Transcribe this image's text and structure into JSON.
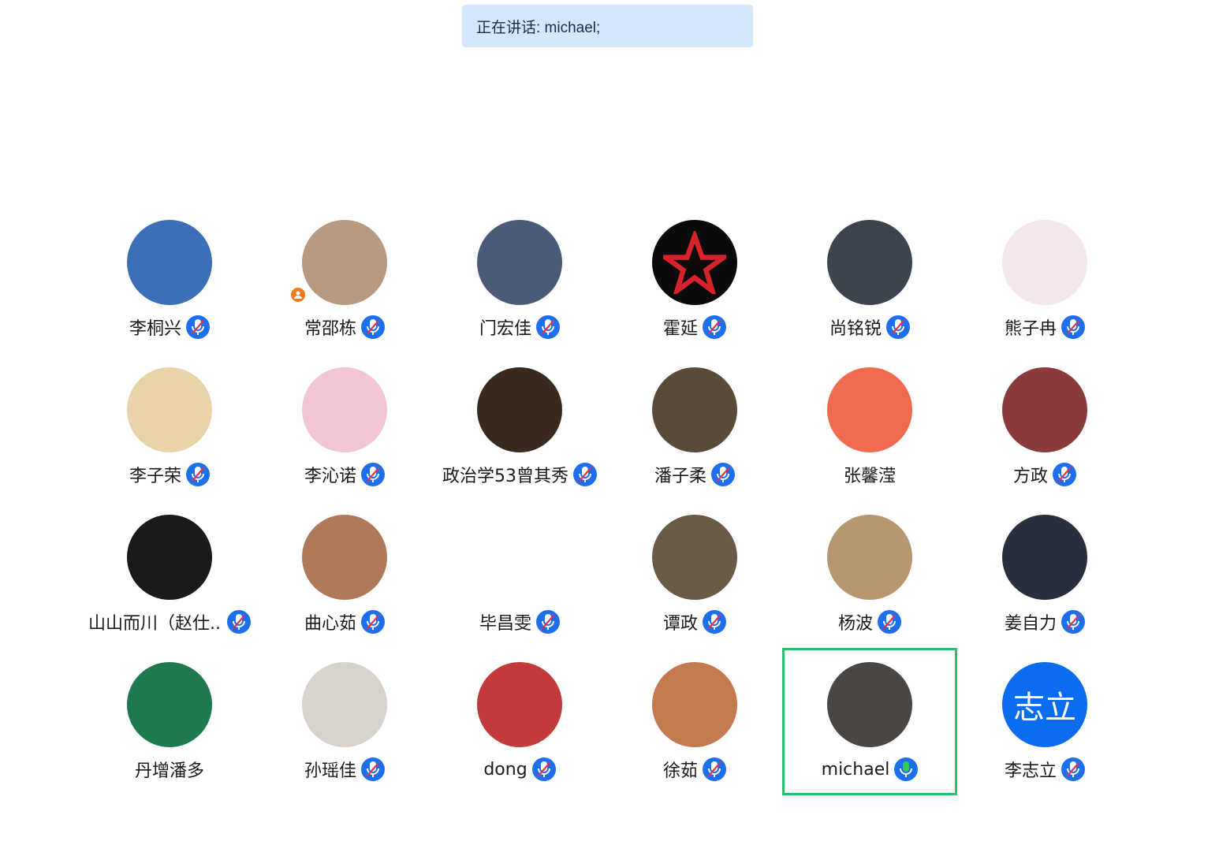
{
  "banner": {
    "text": "正在讲话: michael;"
  },
  "participants": [
    {
      "name": "李桐兴",
      "mic": "muted",
      "avatar_color": "#3b6fb6"
    },
    {
      "name": "常邵栋",
      "mic": "muted",
      "avatar_color": "#b89a82",
      "host": true
    },
    {
      "name": "门宏佳",
      "mic": "muted",
      "avatar_color": "#4a5a78"
    },
    {
      "name": "霍延",
      "mic": "muted",
      "avatar_color": "#0b0b0b",
      "accent": "#d8222a"
    },
    {
      "name": "尚铭锐",
      "mic": "muted",
      "avatar_color": "#3d4450"
    },
    {
      "name": "熊子冉",
      "mic": "muted",
      "avatar_color": "#f5e6ea"
    },
    {
      "name": "李子荣",
      "mic": "muted",
      "avatar_color": "#e8d3a8"
    },
    {
      "name": "李沁诺",
      "mic": "muted",
      "avatar_color": "#f2c6d6"
    },
    {
      "name": "政治学53曾其秀",
      "mic": "muted",
      "avatar_color": "#3a2a1e"
    },
    {
      "name": "潘子柔",
      "mic": "muted",
      "avatar_color": "#5a4a3a"
    },
    {
      "name": "张馨滢",
      "mic": "none",
      "avatar_color": "#f06a4e"
    },
    {
      "name": "方政",
      "mic": "muted",
      "avatar_color": "#8a3a3a"
    },
    {
      "name": "山山而川（赵仕...",
      "mic": "muted",
      "avatar_color": "#1a1a1a"
    },
    {
      "name": "曲心茹",
      "mic": "muted",
      "avatar_color": "#b07a5a"
    },
    {
      "name": "毕昌雯",
      "mic": "muted",
      "avatar_color": "#ffffff"
    },
    {
      "name": "谭政",
      "mic": "muted",
      "avatar_color": "#6a5a48"
    },
    {
      "name": "杨波",
      "mic": "muted",
      "avatar_color": "#b89670"
    },
    {
      "name": "姜自力",
      "mic": "muted",
      "avatar_color": "#2a2f3e"
    },
    {
      "name": "丹增潘多",
      "mic": "none",
      "avatar_color": "#1e7a4e"
    },
    {
      "name": "孙瑶佳",
      "mic": "muted",
      "avatar_color": "#d8d2cc"
    },
    {
      "name": "dong",
      "mic": "muted",
      "avatar_color": "#c23a3a"
    },
    {
      "name": "徐茹",
      "mic": "muted",
      "avatar_color": "#c27a4e"
    },
    {
      "name": "michael",
      "mic": "speaking",
      "avatar_color": "#4a4644",
      "active": true
    },
    {
      "name": "李志立",
      "mic": "muted",
      "avatar_color": "#0a6df0",
      "avatar_text": "志立"
    }
  ],
  "colors": {
    "banner_bg": "#d6e7fc",
    "active_border": "#22c26e",
    "mic_blue": "#1e6ff0",
    "mic_green": "#2ecc55",
    "muted_slash": "#e0324b"
  }
}
